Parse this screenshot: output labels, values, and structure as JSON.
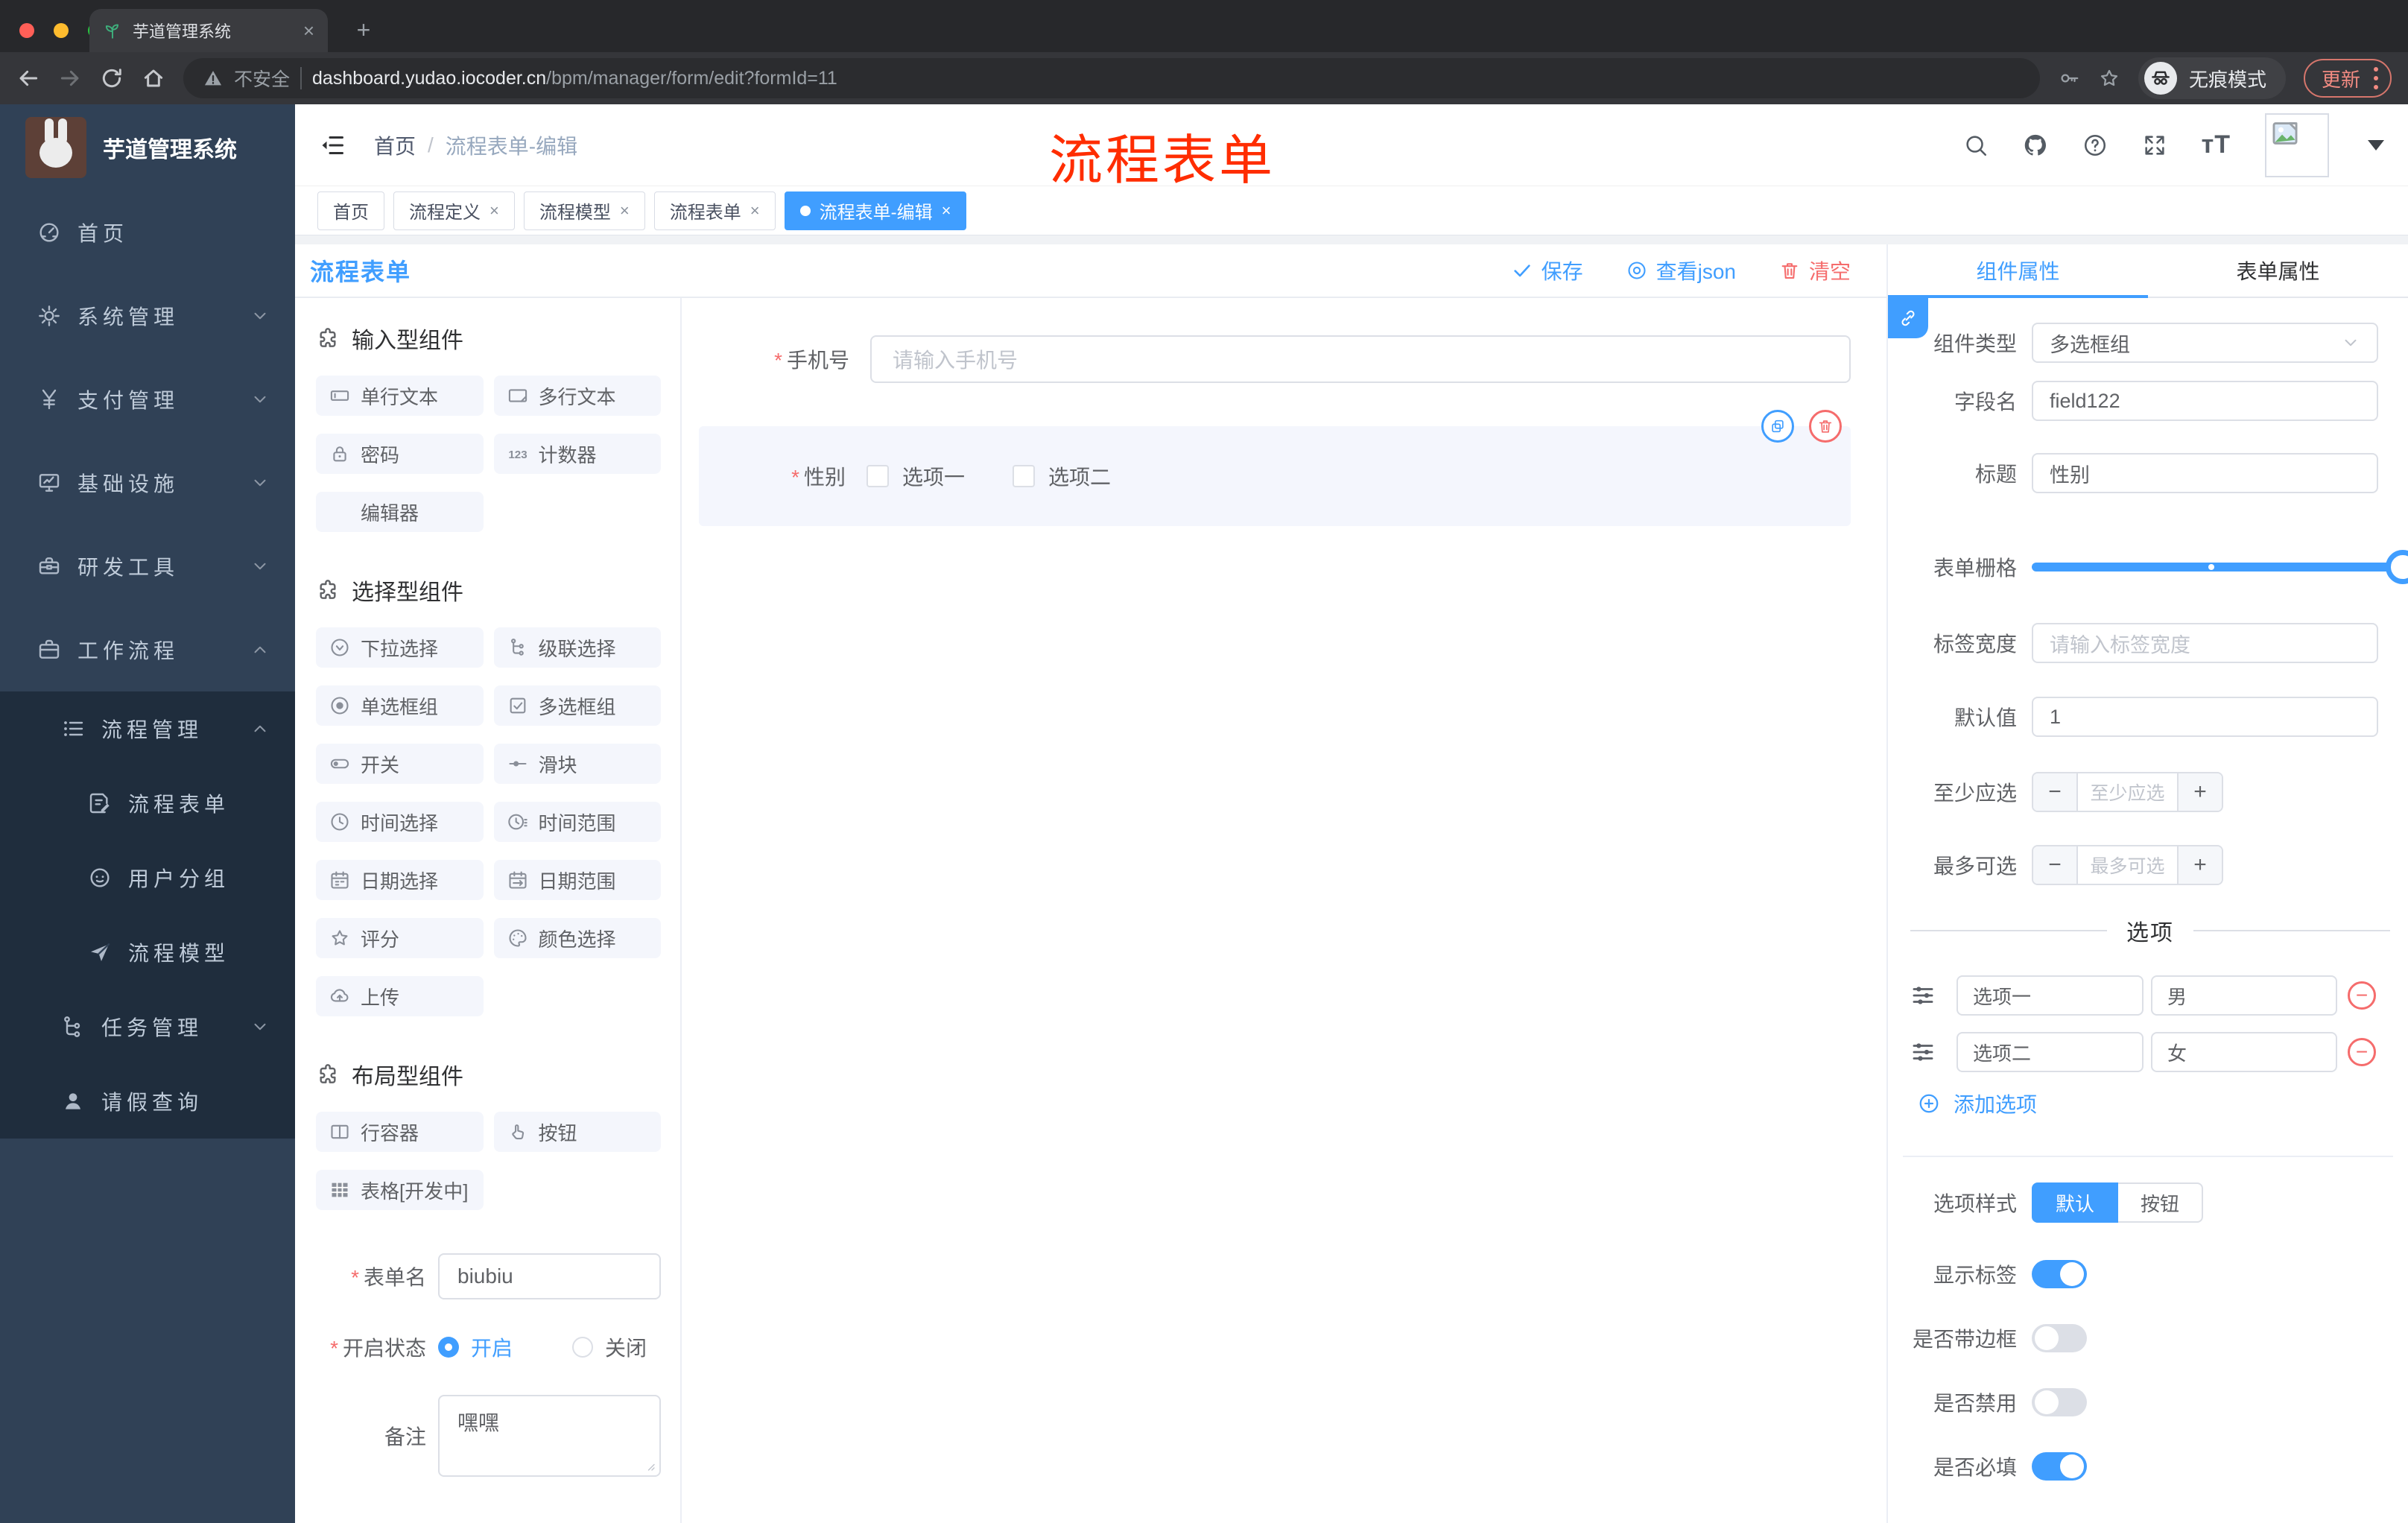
{
  "browser": {
    "tab_title": "芋道管理系统",
    "not_secure": "不安全",
    "url_host": "dashboard.yudao.iocoder.cn",
    "url_path": "/bpm/manager/form/edit?formId=11",
    "incognito_label": "无痕模式",
    "update_label": "更新"
  },
  "sidebar": {
    "brand": "芋道管理系统",
    "items": [
      {
        "icon": "dashboard",
        "label": "首页",
        "level": 0
      },
      {
        "icon": "gear",
        "label": "系统管理",
        "level": 0,
        "arrow": "down"
      },
      {
        "icon": "yen",
        "label": "支付管理",
        "level": 0,
        "arrow": "down"
      },
      {
        "icon": "monitor",
        "label": "基础设施",
        "level": 0,
        "arrow": "down"
      },
      {
        "icon": "toolbox",
        "label": "研发工具",
        "level": 0,
        "arrow": "down"
      },
      {
        "icon": "briefcase",
        "label": "工作流程",
        "level": 0,
        "arrow": "up"
      },
      {
        "icon": "list",
        "label": "流程管理",
        "level": 1,
        "arrow": "up",
        "submenu": true
      },
      {
        "icon": "doc-edit",
        "label": "流程表单",
        "level": 2,
        "submenu": true
      },
      {
        "icon": "face",
        "label": "用户分组",
        "level": 2,
        "submenu": true
      },
      {
        "icon": "send",
        "label": "流程模型",
        "level": 2,
        "submenu": true
      },
      {
        "icon": "tree",
        "label": "任务管理",
        "level": 1,
        "arrow": "down",
        "submenu": true
      },
      {
        "icon": "user",
        "label": "请假查询",
        "level": 1,
        "submenu": true
      }
    ]
  },
  "header": {
    "breadcrumb": [
      "首页",
      "流程表单-编辑"
    ],
    "annotation": "流程表单"
  },
  "tagbar": {
    "tabs": [
      {
        "label": "首页"
      },
      {
        "label": "流程定义",
        "closable": true
      },
      {
        "label": "流程模型",
        "closable": true
      },
      {
        "label": "流程表单",
        "closable": true
      },
      {
        "label": "流程表单-编辑",
        "closable": true,
        "active": true
      }
    ]
  },
  "card": {
    "title": "流程表单",
    "actions": {
      "save": "保存",
      "view_json": "查看json",
      "clear": "清空"
    }
  },
  "components_panel": {
    "sections": [
      {
        "title": "输入型组件",
        "items": [
          {
            "icon": "input",
            "label": "单行文本"
          },
          {
            "icon": "textarea",
            "label": "多行文本"
          },
          {
            "icon": "password",
            "label": "密码"
          },
          {
            "icon": "number",
            "label": "计数器"
          },
          {
            "icon": "",
            "label": "编辑器"
          }
        ]
      },
      {
        "title": "选择型组件",
        "items": [
          {
            "icon": "select",
            "label": "下拉选择"
          },
          {
            "icon": "cascader",
            "label": "级联选择"
          },
          {
            "icon": "radio",
            "label": "单选框组"
          },
          {
            "icon": "checkbox",
            "label": "多选框组"
          },
          {
            "icon": "switch",
            "label": "开关"
          },
          {
            "icon": "slider",
            "label": "滑块"
          },
          {
            "icon": "time",
            "label": "时间选择"
          },
          {
            "icon": "time-range",
            "label": "时间范围"
          },
          {
            "icon": "date",
            "label": "日期选择"
          },
          {
            "icon": "date-range",
            "label": "日期范围"
          },
          {
            "icon": "rate",
            "label": "评分"
          },
          {
            "icon": "color",
            "label": "颜色选择"
          },
          {
            "icon": "upload",
            "label": "上传"
          }
        ]
      },
      {
        "title": "布局型组件",
        "items": [
          {
            "icon": "row",
            "label": "行容器"
          },
          {
            "icon": "button",
            "label": "按钮"
          },
          {
            "icon": "table",
            "label": "表格[开发中]"
          }
        ]
      }
    ],
    "form": {
      "name_label": "表单名",
      "name_value": "biubiu",
      "status_label": "开启状态",
      "status_on": "开启",
      "status_off": "关闭",
      "remark_label": "备注",
      "remark_value": "嘿嘿"
    }
  },
  "canvas": {
    "phone": {
      "label": "手机号",
      "placeholder": "请输入手机号"
    },
    "gender": {
      "label": "性别",
      "options": [
        "选项一",
        "选项二"
      ]
    }
  },
  "props_panel": {
    "tabs": [
      {
        "label": "组件属性",
        "active": true
      },
      {
        "label": "表单属性"
      }
    ],
    "component_type": {
      "label": "组件类型",
      "value": "多选框组"
    },
    "field_name": {
      "label": "字段名",
      "value": "field122"
    },
    "title_field": {
      "label": "标题",
      "value": "性别"
    },
    "grid": {
      "label": "表单栅格"
    },
    "label_width": {
      "label": "标签宽度",
      "placeholder": "请输入标签宽度"
    },
    "default_value": {
      "label": "默认值",
      "value": "1"
    },
    "min_select": {
      "label": "至少应选",
      "placeholder": "至少应选"
    },
    "max_select": {
      "label": "最多可选",
      "placeholder": "最多可选"
    },
    "options_divider": "选项",
    "options": [
      {
        "label": "选项一",
        "value": "男"
      },
      {
        "label": "选项二",
        "value": "女"
      }
    ],
    "add_option": "添加选项",
    "option_style": {
      "label": "选项样式",
      "default_btn": "默认",
      "button_btn": "按钮"
    },
    "toggles": [
      {
        "label": "显示标签",
        "on": true
      },
      {
        "label": "是否带边框",
        "on": false
      },
      {
        "label": "是否禁用",
        "on": false
      },
      {
        "label": "是否必填",
        "on": true
      }
    ]
  },
  "colors": {
    "primary": "#409eff",
    "danger": "#f56c6c",
    "annotation": "#ff2d00"
  }
}
